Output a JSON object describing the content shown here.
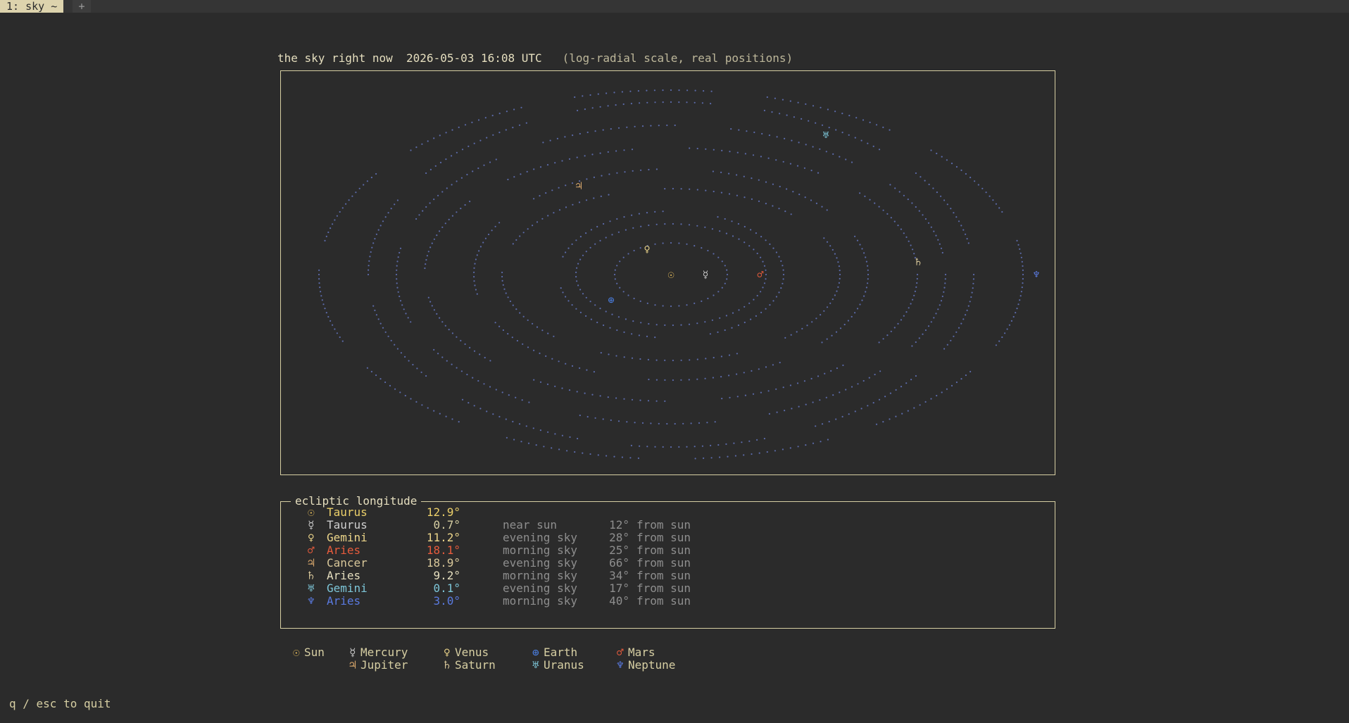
{
  "tabs": {
    "active_label": "1: sky ~",
    "new_label": "+"
  },
  "header": {
    "title": "the sky right now",
    "timestamp": "2026-05-03 16:08 UTC",
    "note": "(log-radial scale, real positions)"
  },
  "colors": {
    "sun": "#e0b85a",
    "mercury": "#c8c8c8",
    "venus": "#ecd58a",
    "earth": "#4a7ee0",
    "mars": "#e65b3c",
    "jupiter": "#d4a46a",
    "saturn": "#d8c79a",
    "uranus": "#7dc6d8",
    "neptune": "#5a7ae0",
    "orbit": "#5b6aa8",
    "text": "#d7cfa3"
  },
  "planets": [
    {
      "name": "Sun",
      "symbol": "☉",
      "color": "#e0b85a"
    },
    {
      "name": "Mercury",
      "symbol": "☿",
      "color": "#c8c8c8"
    },
    {
      "name": "Venus",
      "symbol": "♀",
      "color": "#ecd58a"
    },
    {
      "name": "Earth",
      "symbol": "⊕",
      "color": "#4a7ee0"
    },
    {
      "name": "Mars",
      "symbol": "♂",
      "color": "#e65b3c"
    },
    {
      "name": "Jupiter",
      "symbol": "♃",
      "color": "#d4a46a"
    },
    {
      "name": "Saturn",
      "symbol": "♄",
      "color": "#d8c79a"
    },
    {
      "name": "Uranus",
      "symbol": "♅",
      "color": "#7dc6d8"
    },
    {
      "name": "Neptune",
      "symbol": "♆",
      "color": "#5a7ae0"
    }
  ],
  "panel": {
    "title": "ecliptic longitude",
    "rows": [
      {
        "symbol": "☉",
        "sign": "Taurus",
        "deg": "12.9°",
        "vis": "",
        "dist": "",
        "from": "",
        "icon_color": "#e0b85a",
        "sign_color": "#ecd06a",
        "deg_color": "#ecd06a"
      },
      {
        "symbol": "☿",
        "sign": "Taurus",
        "deg": "0.7°",
        "vis": "near sun",
        "dist": "12°",
        "from": "from sun",
        "icon_color": "#c8c8c8",
        "sign_color": "#cfcfcf",
        "deg_color": "#d7cfa3"
      },
      {
        "symbol": "♀",
        "sign": "Gemini",
        "deg": "11.2°",
        "vis": "evening sky",
        "dist": "28°",
        "from": "from sun",
        "icon_color": "#ecd58a",
        "sign_color": "#ecd58a",
        "deg_color": "#ecd58a"
      },
      {
        "symbol": "♂",
        "sign": "Aries",
        "deg": "18.1°",
        "vis": "morning sky",
        "dist": "25°",
        "from": "from sun",
        "icon_color": "#e65b3c",
        "sign_color": "#e65b3c",
        "deg_color": "#e65b3c"
      },
      {
        "symbol": "♃",
        "sign": "Cancer",
        "deg": "18.9°",
        "vis": "evening sky",
        "dist": "66°",
        "from": "from sun",
        "icon_color": "#d4a46a",
        "sign_color": "#d8c79a",
        "deg_color": "#d8c79a"
      },
      {
        "symbol": "♄",
        "sign": "Aries",
        "deg": "9.2°",
        "vis": "morning sky",
        "dist": "34°",
        "from": "from sun",
        "icon_color": "#d8c79a",
        "sign_color": "#e6dfbf",
        "deg_color": "#e6dfbf"
      },
      {
        "symbol": "♅",
        "sign": "Gemini",
        "deg": "0.1°",
        "vis": "evening sky",
        "dist": "17°",
        "from": "from sun",
        "icon_color": "#7dc6d8",
        "sign_color": "#7dc6d8",
        "deg_color": "#7dc6d8"
      },
      {
        "symbol": "♆",
        "sign": "Aries",
        "deg": "3.0°",
        "vis": "morning sky",
        "dist": "40°",
        "from": "from sun",
        "icon_color": "#5a7ae0",
        "sign_color": "#5a7ae0",
        "deg_color": "#5a7ae0"
      }
    ]
  },
  "legend": [
    {
      "symbol": "☉",
      "name": "Sun",
      "color": "#e0b85a"
    },
    {
      "symbol": "☿",
      "name": "Mercury",
      "color": "#c8c8c8"
    },
    {
      "symbol": "♀",
      "name": "Venus",
      "color": "#ecd58a"
    },
    {
      "symbol": "⊕",
      "name": "Earth",
      "color": "#4a7ee0"
    },
    {
      "symbol": "♂",
      "name": "Mars",
      "color": "#e65b3c"
    },
    {
      "symbol": "♃",
      "name": "Jupiter",
      "color": "#d4a46a"
    },
    {
      "symbol": "♄",
      "name": "Saturn",
      "color": "#d8c79a"
    },
    {
      "symbol": "♅",
      "name": "Uranus",
      "color": "#7dc6d8"
    },
    {
      "symbol": "♆",
      "name": "Neptune",
      "color": "#5a7ae0"
    }
  ],
  "footer": {
    "quit_hint": "q / esc to quit"
  }
}
